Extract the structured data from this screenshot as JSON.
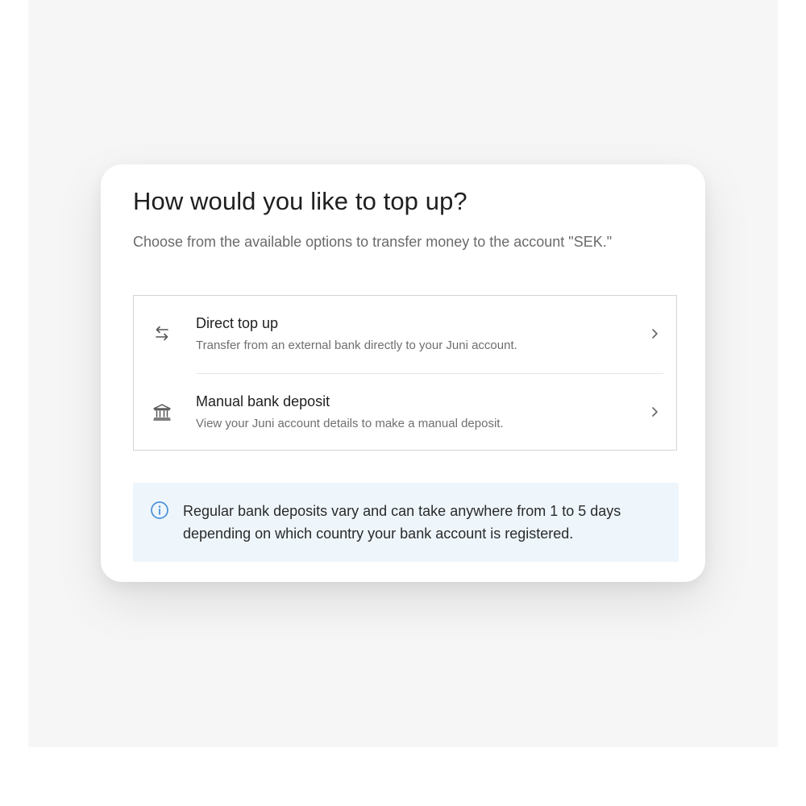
{
  "dialog": {
    "title": "How would you like to top up?",
    "subtitle": "Choose from the available options to transfer money to the account \"SEK.\""
  },
  "options": [
    {
      "title": "Direct top up",
      "description": "Transfer from an external bank directly to your Juni account.",
      "icon": "transfer-arrows-icon"
    },
    {
      "title": "Manual bank deposit",
      "description": "View your Juni account details to make a manual deposit.",
      "icon": "bank-icon"
    }
  ],
  "info": {
    "icon": "info-icon",
    "text": "Regular bank deposits vary and can take anywhere from 1 to 5 days depending on which country your bank account is registered."
  },
  "colors": {
    "page_background": "#f6f6f6",
    "card_background": "#ffffff",
    "info_background": "#eef6fc",
    "info_icon": "#4a90d9",
    "primary_text": "#1f1f1f",
    "secondary_text": "#6f6f6f"
  }
}
